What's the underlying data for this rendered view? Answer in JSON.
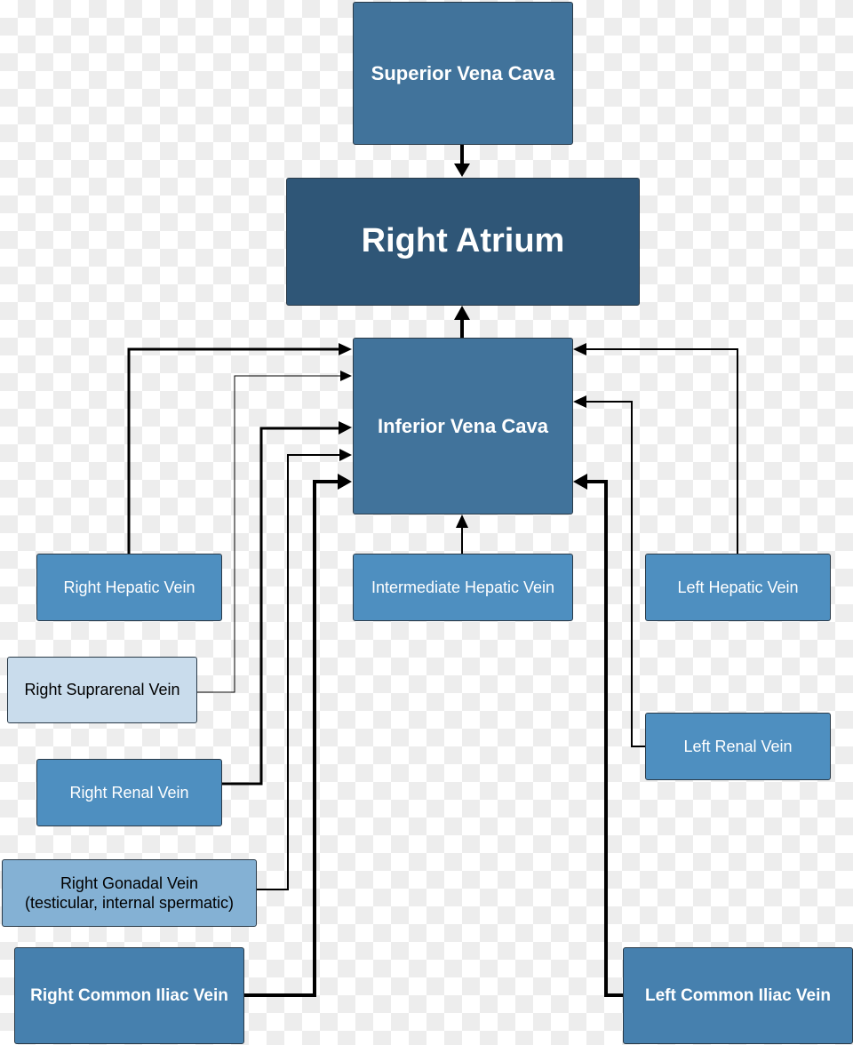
{
  "nodes": {
    "superior_vena_cava": "Superior Vena Cava",
    "right_atrium": "Right Atrium",
    "inferior_vena_cava": "Inferior Vena Cava",
    "right_hepatic_vein": "Right Hepatic Vein",
    "intermediate_hepatic_vein": "Intermediate Hepatic Vein",
    "left_hepatic_vein": "Left Hepatic Vein",
    "right_suprarenal_vein": "Right Suprarenal Vein",
    "right_renal_vein": "Right Renal Vein",
    "left_renal_vein": "Left Renal Vein",
    "right_gonadal_vein_line1": "Right Gonadal Vein",
    "right_gonadal_vein_line2": "(testicular, internal spermatic)",
    "right_common_iliac_vein": "Right Common Iliac Vein",
    "left_common_iliac_vein": "Left Common Iliac Vein"
  },
  "colors": {
    "vena_cava": "#41739b",
    "atrium": "#2f5677",
    "tributary": "#4e8fc0",
    "suprarenal": "#c9dcec",
    "gonadal": "#84b1d4",
    "iliac": "#4680ae"
  }
}
